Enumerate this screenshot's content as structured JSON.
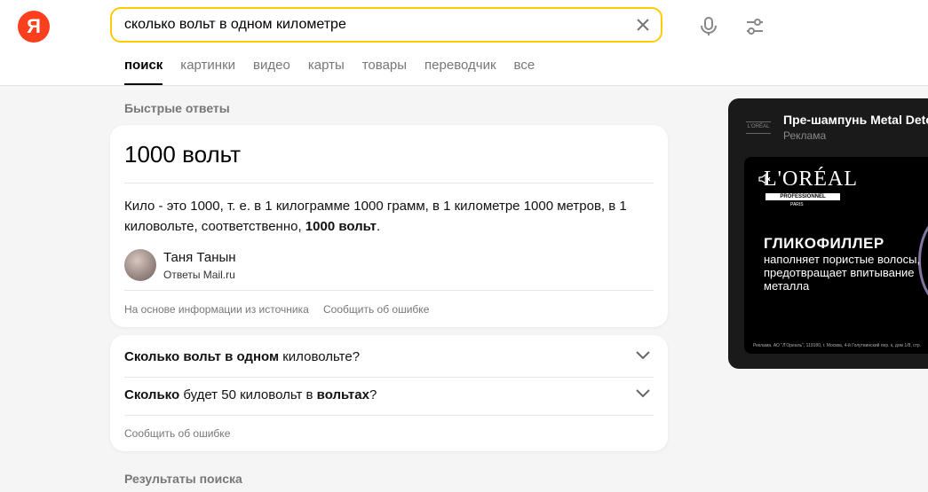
{
  "logo": {
    "letter": "Я"
  },
  "search": {
    "value": "сколько вольт в одном километре",
    "placeholder": ""
  },
  "tabs": [
    {
      "label": "поиск",
      "active": true
    },
    {
      "label": "картинки"
    },
    {
      "label": "видео"
    },
    {
      "label": "карты"
    },
    {
      "label": "товары"
    },
    {
      "label": "переводчик"
    },
    {
      "label": "все"
    }
  ],
  "quick_answers": {
    "section_title": "Быстрые ответы",
    "answer_title": "1000 вольт",
    "answer_text": "Кило - это 1000, т. е. в 1 килограмме 1000 грамм, в 1 километре 1000 метров, в 1 киловольте, соответственно, ",
    "answer_text_bold": "1000 вольт",
    "answer_text_end": ".",
    "author_name": "Таня Танын",
    "author_source": "Ответы Mail.ru",
    "based_on": "На основе информации из источника",
    "report": "Сообщить об ошибке"
  },
  "related": {
    "q1": {
      "b1": "Сколько вольт в одном",
      "t1": " киловольте?"
    },
    "q2": {
      "b1": "Сколько",
      "t1": " будет 50 киловольт в ",
      "b2": "вольтах",
      "t2": "?"
    },
    "report": "Сообщить об ошибке"
  },
  "results_title": "Результаты поиска",
  "ad": {
    "title": "Пре-шампунь Metal Detox",
    "label": "Реклама",
    "logo": "L'ORÉAL",
    "logo_sub": "PROFESSIONNEL",
    "logo_city": "PARIS",
    "heading": "ГЛИКОФИЛЛЕР",
    "body": "наполняет пористые волосы, предотвращает впитывание металла",
    "fine": "Реклама. АО \"Л'Ореаль\", 119180, г. Москва, 4-й Голутвинский пер. к, дом 1/8, стр."
  },
  "colors": {
    "accent": "#ffcc00",
    "brand": "#fc3f1d"
  }
}
